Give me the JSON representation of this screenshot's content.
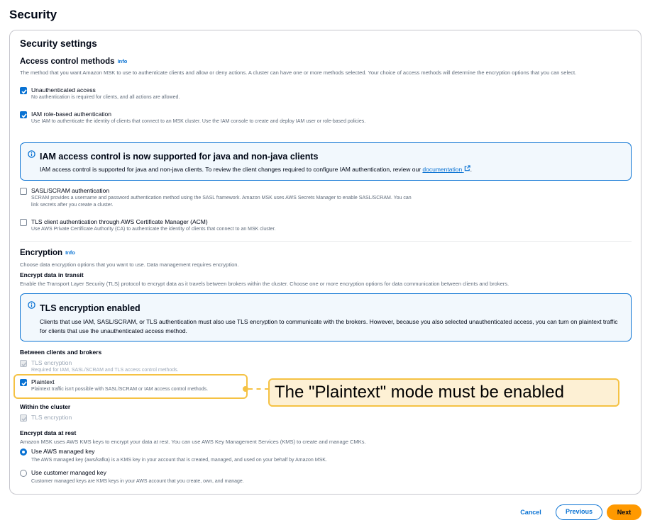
{
  "page": {
    "title": "Security"
  },
  "panel": {
    "title": "Security settings"
  },
  "access_control": {
    "heading": "Access control methods",
    "info": "Info",
    "description": "The method that you want Amazon MSK to use to authenticate clients and allow or deny actions. A cluster can have one or more methods selected. Your choice of access methods will determine the encryption options that you can select.",
    "options": [
      {
        "label": "Unauthenticated access",
        "description": "No authentication is required for clients, and all actions are allowed.",
        "checked": true
      },
      {
        "label": "IAM role-based authentication",
        "description": "Use IAM to authenticate the identity of clients that connect to an MSK cluster. Use the IAM console to create and deploy IAM user or role-based policies.",
        "checked": true
      },
      {
        "label": "SASL/SCRAM authentication",
        "description": "SCRAM provides a username and password authentication method using the SASL framework. Amazon MSK uses AWS Secrets Manager to enable SASL/SCRAM. You can link secrets after you create a cluster.",
        "checked": false
      },
      {
        "label": "TLS client authentication through AWS Certificate Manager (ACM)",
        "description": "Use AWS Private Certificate Authority (CA) to authenticate the identity of clients that connect to an MSK cluster.",
        "checked": false
      }
    ],
    "alert": {
      "title": "IAM access control is now supported for java and non-java clients",
      "body": "IAM access control is supported for java and non-java clients. To review the client changes required to configure IAM authentication, review our",
      "link": "documentation",
      "body_end": "."
    }
  },
  "encryption": {
    "heading": "Encryption",
    "info": "Info",
    "description": "Choose data encryption options that you want to use. Data management requires encryption.",
    "in_transit_heading": "Encrypt data in transit",
    "in_transit_description": "Enable the Transport Layer Security (TLS) protocol to encrypt data as it travels between brokers within the cluster. Choose one or more encryption options for data communication between clients and brokers.",
    "alert": {
      "title": "TLS encryption enabled",
      "body": "Clients that use IAM, SASL/SCRAM, or TLS authentication must also use TLS encryption to communicate with the brokers. However, because you also selected unauthenticated access, you can turn on plaintext traffic for clients that use the unauthenticated access method."
    },
    "between_heading": "Between clients and brokers",
    "tls_option": {
      "label": "TLS encryption",
      "description": "Required for IAM, SASL/SCRAM and TLS access control methods.",
      "checked": true,
      "disabled": true
    },
    "plaintext_option": {
      "label": "Plaintext",
      "description": "Plaintext traffic isn't possible with SASL/SCRAM or IAM access control methods.",
      "checked": true
    },
    "within_heading": "Within the cluster",
    "within_tls_option": {
      "label": "TLS encryption",
      "checked": true,
      "disabled": true
    },
    "at_rest_heading": "Encrypt data at rest",
    "at_rest_description": "Amazon MSK uses AWS KMS keys to encrypt your data at rest. You can use AWS Key Management Services (KMS) to create and manage CMKs.",
    "at_rest_options": [
      {
        "label": "Use AWS managed key",
        "description": "The AWS managed key (aws/kafka) is a KMS key in your account that is created, managed, and used on your behalf by Amazon MSK.",
        "selected": true
      },
      {
        "label": "Use customer managed key",
        "description": "Customer managed keys are KMS keys in your AWS account that you create, own, and manage.",
        "selected": false
      }
    ]
  },
  "annotation": {
    "text": "The \"Plaintext\" mode must be enabled",
    "color": "#f5c244"
  },
  "footer": {
    "cancel": "Cancel",
    "previous": "Previous",
    "next": "Next"
  },
  "colors": {
    "accent": "#0972d3",
    "primary_button": "#ff9900",
    "info_alert_bg": "#f2f8fd"
  },
  "icons": {
    "check": "check-icon",
    "info": "info-circle-icon",
    "external": "external-link-icon"
  }
}
